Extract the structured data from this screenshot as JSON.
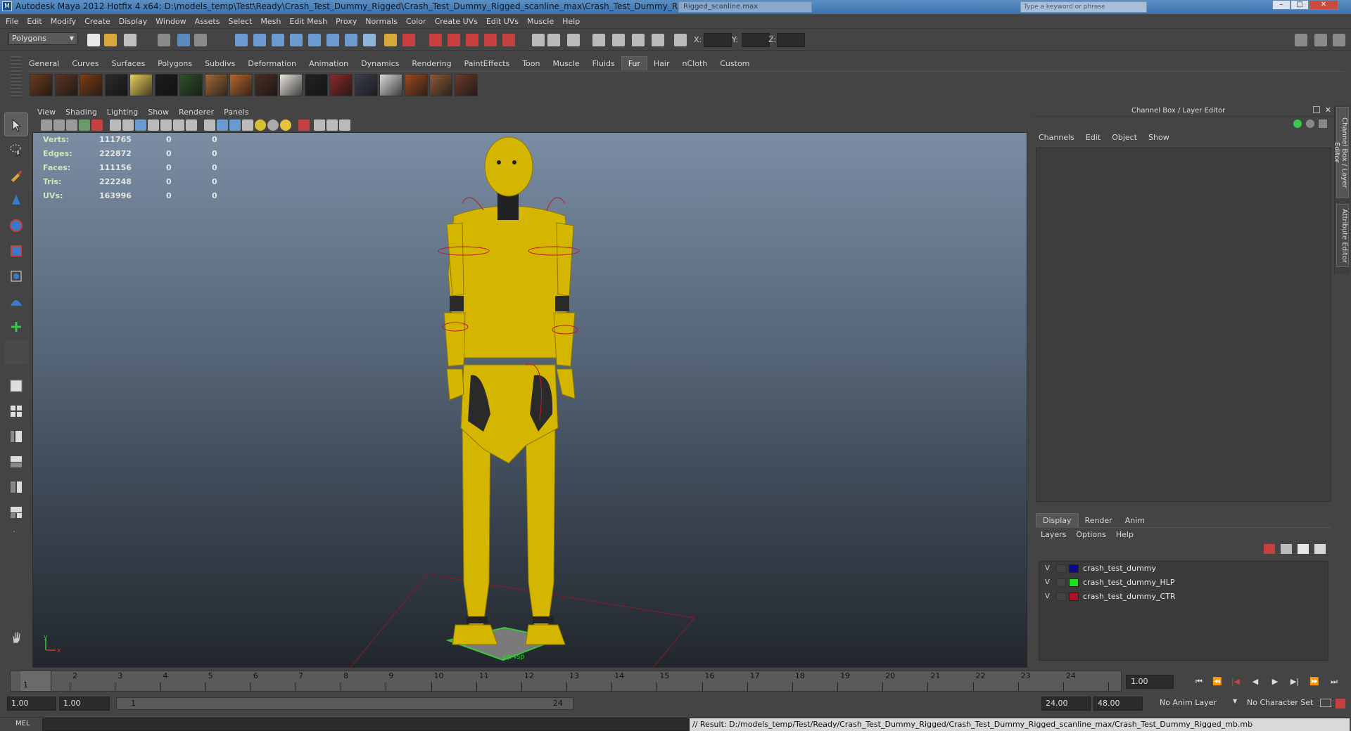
{
  "window": {
    "title": "Autodesk Maya 2012 Hotfix 4 x64: D:\\models_temp\\Test\\Ready\\Crash_Test_Dummy_Rigged\\Crash_Test_Dummy_Rigged_scanline_max\\Crash_Test_Dummy_Rigged_mb.mb",
    "second_tab": "Rigged_scanline.max",
    "search_placeholder": "Type a keyword or phrase",
    "minimize": "–",
    "maximize": "□",
    "close": "✕"
  },
  "menubar": [
    "File",
    "Edit",
    "Modify",
    "Create",
    "Display",
    "Window",
    "Assets",
    "Select",
    "Mesh",
    "Edit Mesh",
    "Proxy",
    "Normals",
    "Color",
    "Create UVs",
    "Edit UVs",
    "Muscle",
    "Help"
  ],
  "statusline": {
    "mode": "Polygons",
    "x_label": "X:",
    "y_label": "Y:",
    "z_label": "Z:"
  },
  "shelf": {
    "tabs": [
      "General",
      "Curves",
      "Surfaces",
      "Polygons",
      "Subdivs",
      "Deformation",
      "Animation",
      "Dynamics",
      "Rendering",
      "PaintEffects",
      "Toon",
      "Muscle",
      "Fluids",
      "Fur",
      "Hair",
      "nCloth",
      "Custom"
    ],
    "active_tab": "Fur",
    "fur_colors": [
      "#6b3a1e",
      "#5a3426",
      "#7a3d17",
      "#2a2a2a",
      "#e8d05a",
      "#1c1c1c",
      "#2f4f2a",
      "#a0683a",
      "#b5652e",
      "#4a2e24",
      "#e8e4dc",
      "#222222",
      "#8a2a2a",
      "#3a3f4a",
      "#d8d8d8",
      "#9a4a22",
      "#8a5a3a",
      "#6a3a2a"
    ]
  },
  "viewport": {
    "menu": [
      "View",
      "Shading",
      "Lighting",
      "Show",
      "Renderer",
      "Panels"
    ],
    "hud": [
      {
        "label": "Verts:",
        "value": "111765",
        "c0": "0",
        "c1": "0"
      },
      {
        "label": "Edges:",
        "value": "222872",
        "c0": "0",
        "c1": "0"
      },
      {
        "label": "Faces:",
        "value": "111156",
        "c0": "0",
        "c1": "0"
      },
      {
        "label": "Tris:",
        "value": "222248",
        "c0": "0",
        "c1": "0"
      },
      {
        "label": "UVs:",
        "value": "163996",
        "c0": "0",
        "c1": "0"
      }
    ],
    "axis_y": "y",
    "axis_x": "x",
    "pedestal_label": "pp4sp",
    "model_color": "#d4b600"
  },
  "channel_box": {
    "header": "Channel Box / Layer Editor",
    "menu": [
      "Channels",
      "Edit",
      "Object",
      "Show"
    ]
  },
  "layer_editor": {
    "tabs": [
      "Display",
      "Render",
      "Anim"
    ],
    "active_tab": "Display",
    "menu": [
      "Layers",
      "Options",
      "Help"
    ],
    "layers": [
      {
        "visible": "V",
        "color": "#0a0a8a",
        "name": "crash_test_dummy"
      },
      {
        "visible": "V",
        "color": "#18e418",
        "name": "crash_test_dummy_HLP"
      },
      {
        "visible": "V",
        "color": "#b0102a",
        "name": "crash_test_dummy_CTR"
      }
    ]
  },
  "side_tabs": [
    "Channel Box / Layer Editor",
    "Attribute Editor"
  ],
  "timeslider": {
    "ticks": [
      "1",
      "2",
      "3",
      "4",
      "5",
      "6",
      "7",
      "8",
      "9",
      "10",
      "11",
      "12",
      "13",
      "14",
      "15",
      "16",
      "17",
      "18",
      "19",
      "20",
      "21",
      "22",
      "23",
      "24"
    ],
    "current_marker": "1",
    "current_frame": "1.00"
  },
  "range": {
    "start": "1.00",
    "playback_start": "1.00",
    "slider_start": "1",
    "slider_end": "24",
    "playback_end": "24.00",
    "end": "48.00",
    "anim_layer": "No Anim Layer",
    "char_set": "No Character Set"
  },
  "cmdline": {
    "lang": "MEL",
    "result": "// Result: D:/models_temp/Test/Ready/Crash_Test_Dummy_Rigged/Crash_Test_Dummy_Rigged_scanline_max/Crash_Test_Dummy_Rigged_mb.mb"
  }
}
